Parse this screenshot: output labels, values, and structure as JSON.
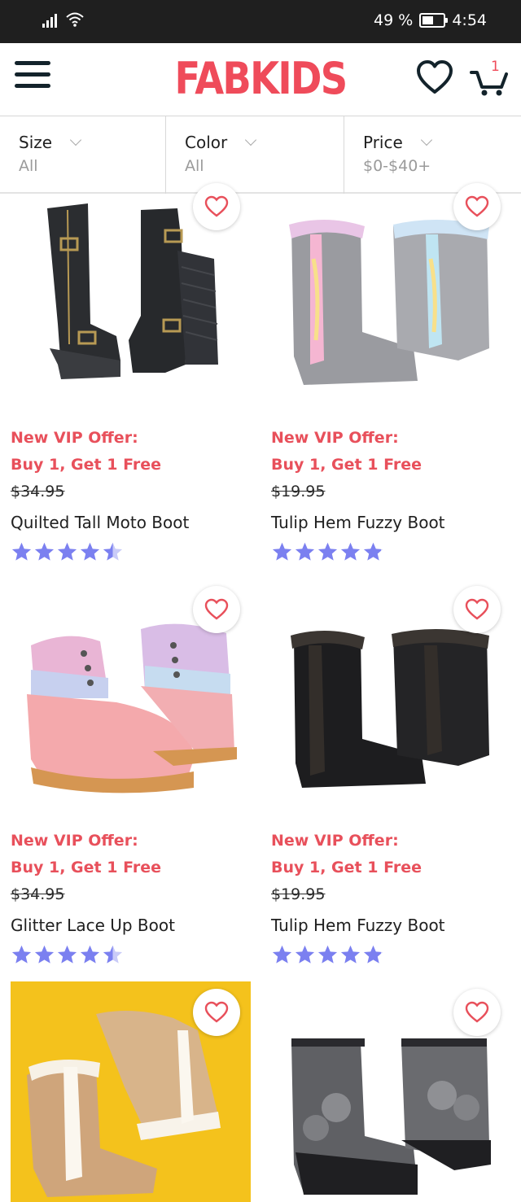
{
  "status_bar": {
    "battery": "49 %",
    "time": "4:54"
  },
  "header": {
    "logo": "FABKIDS",
    "cart_count": "1"
  },
  "filters": [
    {
      "name": "Size",
      "value": "All"
    },
    {
      "name": "Color",
      "value": "All"
    },
    {
      "name": "Price",
      "value": "$0-$40+"
    }
  ],
  "products": [
    {
      "offer_line1": "New VIP Offer:",
      "offer_line2": "Buy 1, Get 1 Free",
      "price": "$34.95",
      "name": "Quilted Tall Moto Boot",
      "rating": 4.5
    },
    {
      "offer_line1": "New VIP Offer:",
      "offer_line2": "Buy 1, Get 1 Free",
      "price": "$19.95",
      "name": "Tulip Hem Fuzzy Boot",
      "rating": 4.9
    },
    {
      "offer_line1": "New VIP Offer:",
      "offer_line2": "Buy 1, Get 1 Free",
      "price": "$34.95",
      "name": "Glitter Lace Up Boot",
      "rating": 4.5
    },
    {
      "offer_line1": "New VIP Offer:",
      "offer_line2": "Buy 1, Get 1 Free",
      "price": "$19.95",
      "name": "Tulip Hem Fuzzy Boot",
      "rating": 4.9
    },
    {
      "offer_line1": "",
      "offer_line2": "",
      "price": "",
      "name": "",
      "rating": null
    },
    {
      "offer_line1": "",
      "offer_line2": "",
      "price": "",
      "name": "",
      "rating": null
    }
  ],
  "colors": {
    "brand": "#ef4b5a",
    "offer": "#e8505b",
    "star": "#7b80f0",
    "star_empty": "#c9cbf8"
  }
}
